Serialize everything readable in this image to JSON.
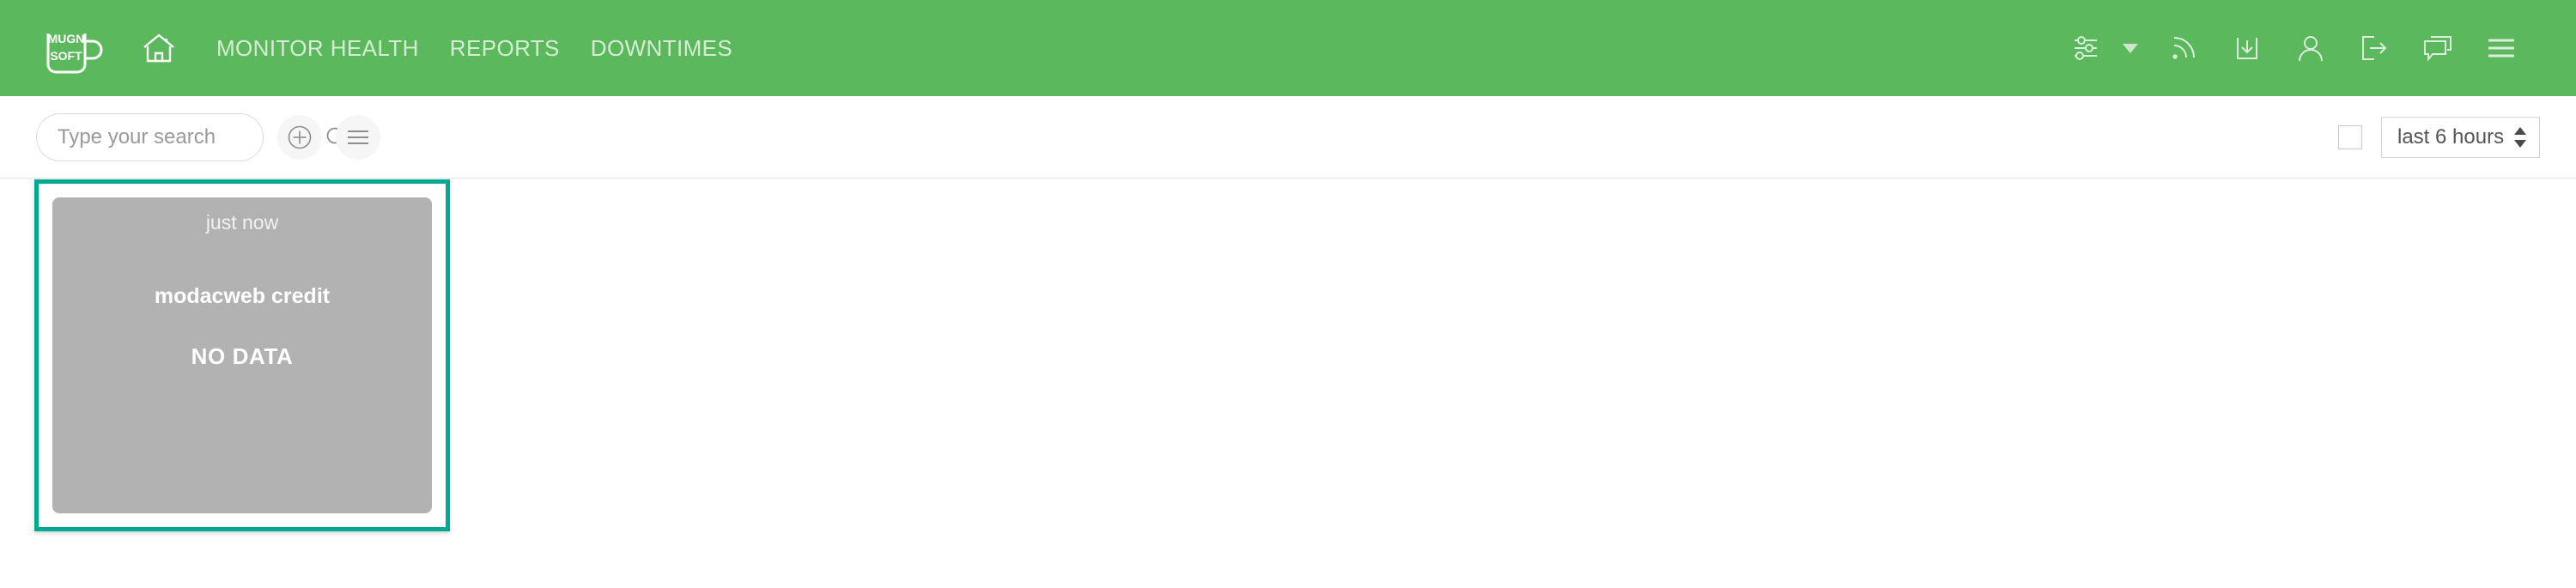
{
  "header": {
    "brand": {
      "logo_icon": "mug-logo-icon",
      "line1": "MUGN",
      "line2": "SOFT"
    },
    "home_icon": "home-icon",
    "nav": [
      {
        "label": "MONITOR HEALTH"
      },
      {
        "label": "REPORTS"
      },
      {
        "label": "DOWNTIMES"
      }
    ],
    "icons": [
      {
        "name": "sliders-icon"
      },
      {
        "name": "chevron-down-icon"
      },
      {
        "name": "rss-feed-icon"
      },
      {
        "name": "download-icon"
      },
      {
        "name": "user-icon"
      },
      {
        "name": "logout-icon"
      },
      {
        "name": "chat-bubble-icon"
      },
      {
        "name": "hamburger-menu-icon"
      }
    ],
    "bar_color": "#5cb85c",
    "nav_link_color": "#d6ecd4"
  },
  "toolbar": {
    "search": {
      "value": "",
      "placeholder": "Type your search",
      "icon": "search-icon"
    },
    "add_button_icon": "plus-circle-icon",
    "list_button_icon": "list-menu-icon",
    "checkbox_checked": false,
    "time_range": {
      "selected": "last 6 hours",
      "options": [
        "last 6 hours"
      ],
      "spinner_icon": "updown-spinner-icon"
    }
  },
  "content": {
    "tiles": [
      {
        "time": "just now",
        "title": "modacweb credit",
        "status": "NO DATA",
        "selected": true,
        "border_color": "#00a98f",
        "panel_color": "#b2b2b2"
      }
    ]
  }
}
